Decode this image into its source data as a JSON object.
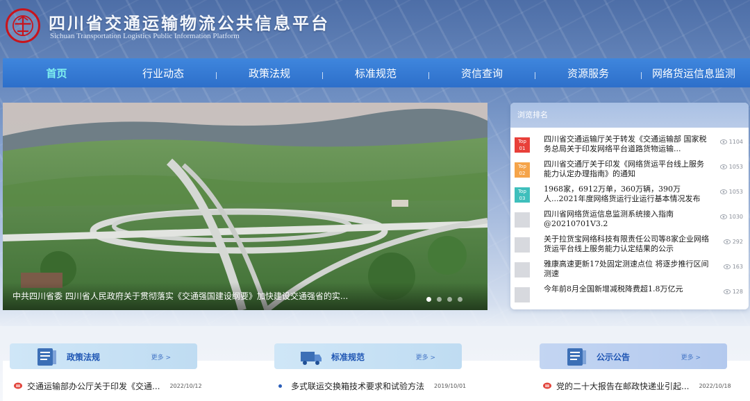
{
  "header": {
    "title_cn": "四川省交通运输物流公共信息平台",
    "title_en": "Sichuan Transportation Logistics Public Information Platform",
    "logo_icon": "emblem-icon"
  },
  "nav": {
    "items": [
      {
        "label": "首页",
        "active": true
      },
      {
        "label": "行业动态"
      },
      {
        "label": "政策法规"
      },
      {
        "label": "标准规范"
      },
      {
        "label": "资信查询"
      },
      {
        "label": "资源服务"
      },
      {
        "label": "网络货运信息监测"
      }
    ]
  },
  "carousel": {
    "caption": "中共四川省委 四川省人民政府关于贯彻落实《交通强国建设纲要》加快建设交通强省的实...",
    "slide_count": 4,
    "active_index": 0
  },
  "ranking": {
    "title": "浏览排名",
    "items": [
      {
        "badge_top": "Top",
        "badge_num": "01",
        "color": "#e8403a",
        "text": "四川省交通运输厅关于转发《交通运输部 国家税务总局关于印发网络平台道路货物运输...",
        "views": "1104"
      },
      {
        "badge_top": "Top",
        "badge_num": "02",
        "color": "#f5a44a",
        "text": "四川省交通厅关于印发《网络货运平台线上服务能力认定办理指南》的通知",
        "views": "1053"
      },
      {
        "badge_top": "Top",
        "badge_num": "03",
        "color": "#3fbfbc",
        "text": "1968家，6912万单，360万辆，390万人...2021年度网络货运行业运行基本情况发布",
        "views": "1053"
      },
      {
        "badge_top": "",
        "badge_num": "",
        "color": "#d7d9de",
        "text": "四川省网络货运信息监测系统接入指南@20210701V3.2",
        "views": "1030"
      },
      {
        "badge_top": "",
        "badge_num": "",
        "color": "#d7d9de",
        "text": "关于拉货宝网络科技有限责任公司等8家企业网络货运平台线上服务能力认定结果的公示",
        "views": "292"
      },
      {
        "badge_top": "",
        "badge_num": "",
        "color": "#d7d9de",
        "text": "雅康高速更新17处固定测速点位 将逐步推行区间测速",
        "views": "163"
      },
      {
        "badge_top": "",
        "badge_num": "",
        "color": "#d7d9de",
        "text": "今年前8月全国新增减税降费超1.8万亿元",
        "views": "128"
      }
    ]
  },
  "columns": [
    {
      "title": "政策法规",
      "more": "更多 >",
      "icon": "document-list-icon",
      "news_text": "交通运输部办公厅关于印发《交通...",
      "news_date": "2022/10/12",
      "bullet": "news-icon"
    },
    {
      "title": "标准规范",
      "more": "更多 >",
      "icon": "truck-icon",
      "news_text": "多式联运交换箱技术要求和试验方法",
      "news_date": "2019/10/01",
      "bullet": "dot"
    },
    {
      "title": "公示公告",
      "more": "更多 >",
      "icon": "document-list-icon",
      "news_text": "党的二十大报告在邮政快递业引起...",
      "news_date": "2022/10/18",
      "bullet": "news-icon"
    }
  ]
}
